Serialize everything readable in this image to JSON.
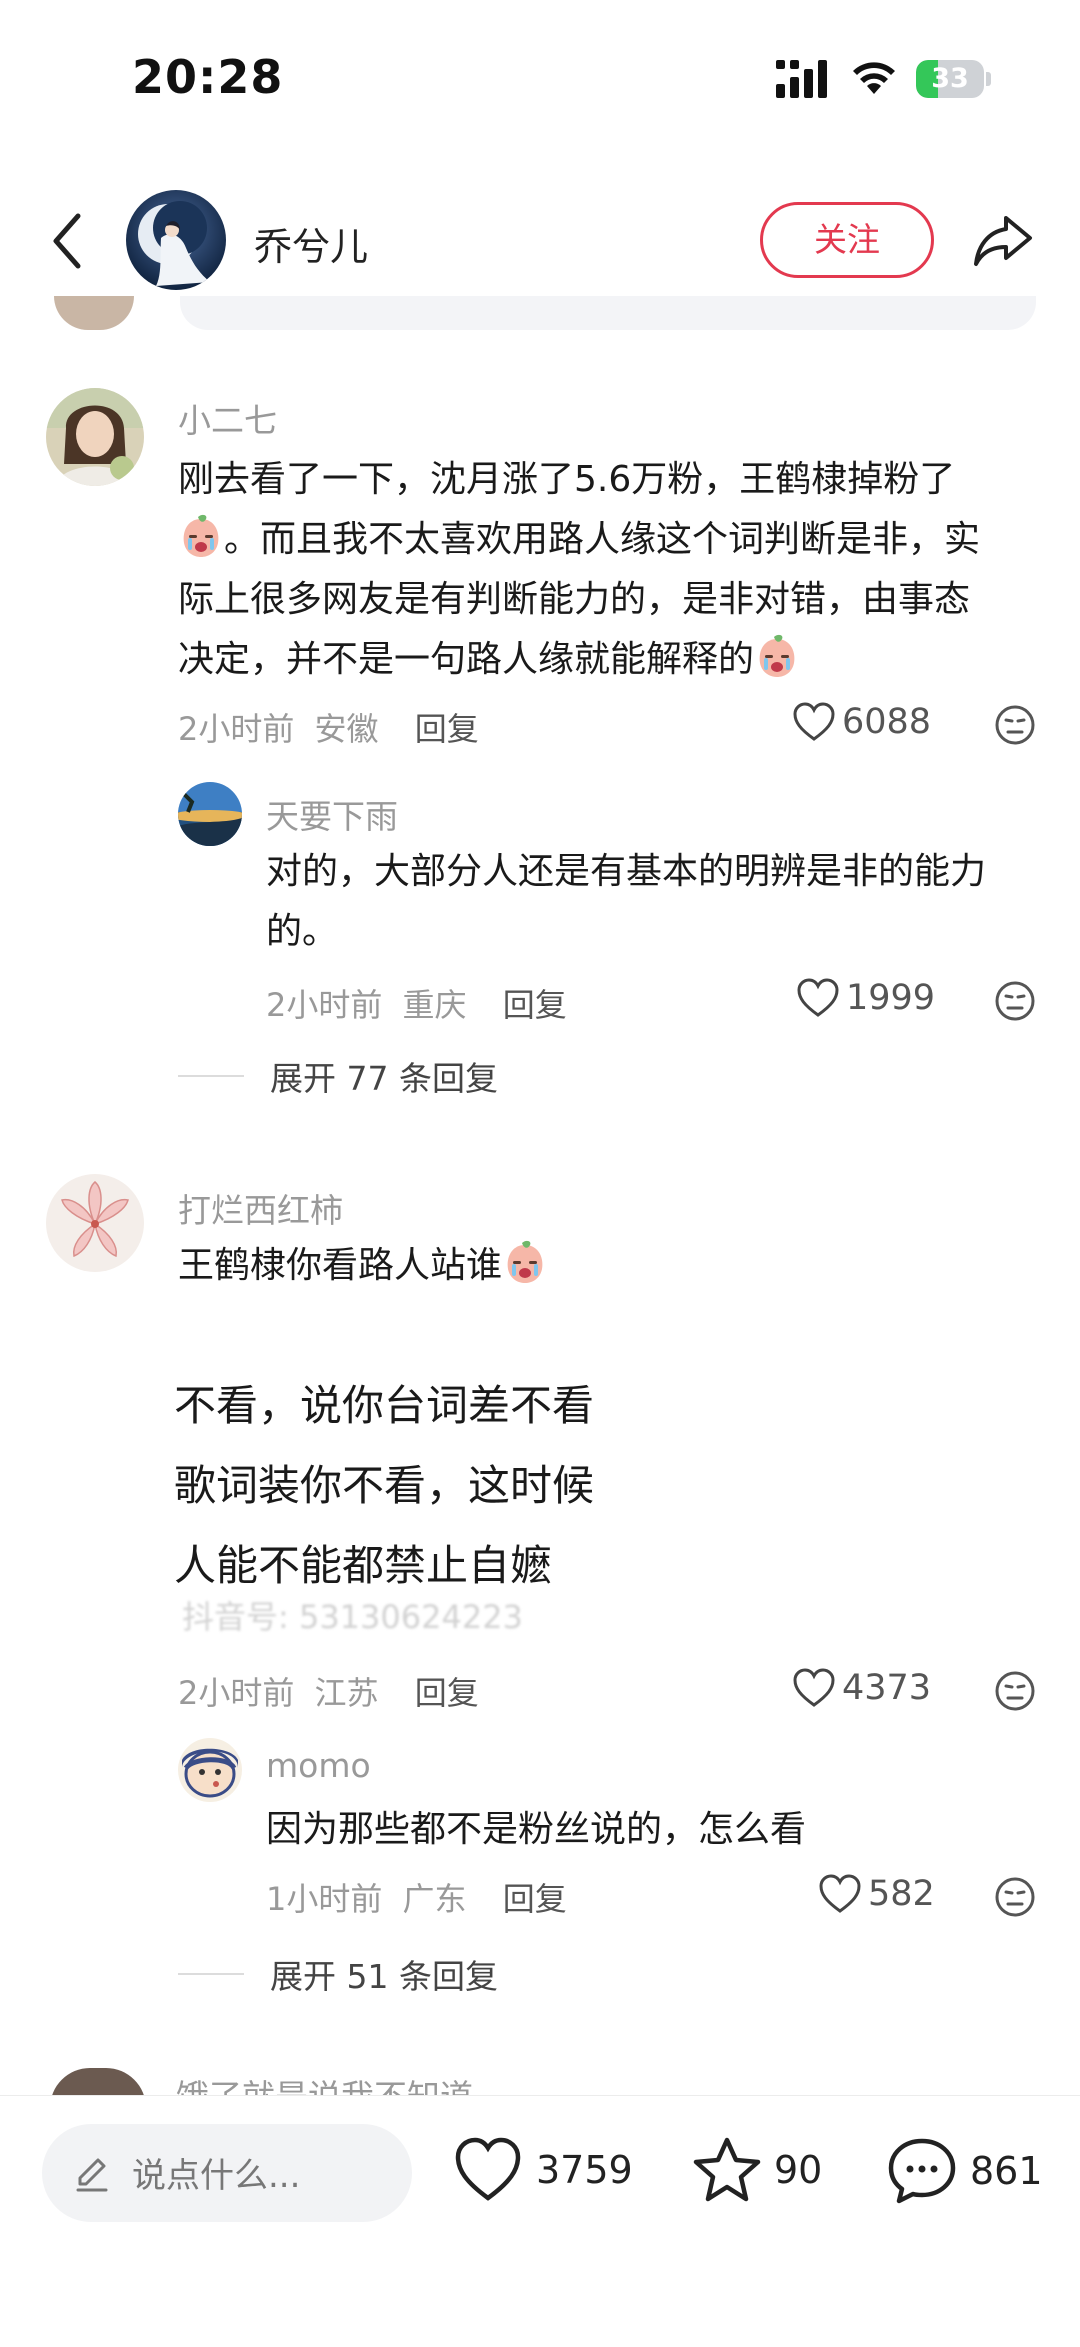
{
  "status_bar": {
    "time": "20:28",
    "battery": "33",
    "battery_level": 0.33
  },
  "header": {
    "username": "乔兮儿",
    "follow_label": "关注"
  },
  "comments": [
    {
      "user": "小二七",
      "lines": [
        "刚去看了一下，沈月涨了5.6万粉，王鹤棣掉粉了",
        "。而且我不太喜欢用路人缘这个词判断是非，实",
        "际上很多网友是有判断能力的，是非对错，由事态",
        "决定，并不是一句路人缘就能解释的"
      ],
      "time": "2小时前",
      "location": "安徽",
      "reply_label": "回复",
      "likes": "6088",
      "replies": [
        {
          "user": "天要下雨",
          "lines": [
            "对的，大部分人还是有基本的明辨是非的能力",
            "的。"
          ],
          "time": "2小时前",
          "location": "重庆",
          "reply_label": "回复",
          "likes": "1999"
        }
      ],
      "expand_label": "展开 77 条回复"
    },
    {
      "user": "打烂西红柿",
      "lines": [
        "王鹤棣你看路人站谁"
      ],
      "image_lines": [
        "不看，说你台词差不看",
        "歌词装你不看，这时候",
        "人能不能都禁止自嬷"
      ],
      "image_watermark": "抖音号: 53130624223",
      "time": "2小时前",
      "location": "江苏",
      "reply_label": "回复",
      "likes": "4373",
      "replies": [
        {
          "user": "momo",
          "lines": [
            "因为那些都不是粉丝说的，怎么看"
          ],
          "time": "1小时前",
          "location": "广东",
          "reply_label": "回复",
          "likes": "582"
        }
      ],
      "expand_label": "展开 51 条回复"
    }
  ],
  "cut_off_user": "饿了就是说我不知道",
  "bottom_bar": {
    "placeholder": "说点什么...",
    "likes": "3759",
    "favorites": "90",
    "comments": "861"
  },
  "colors": {
    "accent": "#e3394f",
    "muted": "#999999"
  }
}
